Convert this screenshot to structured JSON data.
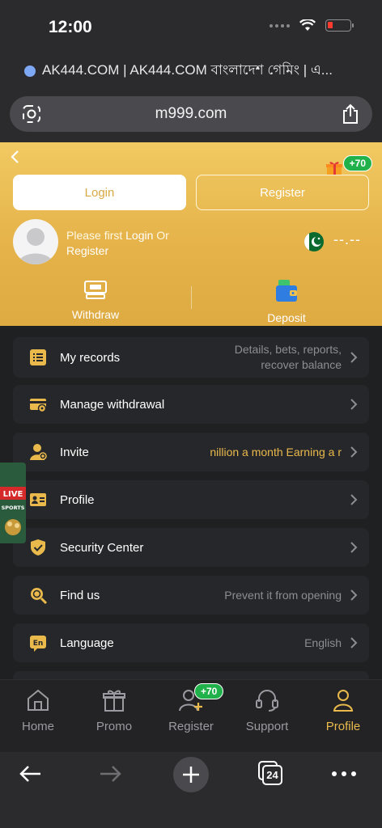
{
  "status": {
    "time": "12:00"
  },
  "browser": {
    "tab_title": "AK444.COM | AK444.COM বাংলাদেশ গেমিং | এ...",
    "url": "m999.com",
    "tab_count": "24"
  },
  "header": {
    "bonus_badge": "+70",
    "login_label": "Login",
    "register_label": "Register",
    "prompt_prefix": "Please first",
    "prompt_login": "Login",
    "prompt_or": "Or",
    "prompt_register": "Register",
    "balance": "--.--",
    "withdraw_label": "Withdraw",
    "deposit_label": "Deposit"
  },
  "menu": [
    {
      "label": "My records",
      "desc_line1": "Details, bets, reports,",
      "desc_line2": "recover balance",
      "icon": "records-icon"
    },
    {
      "label": "Manage withdrawal",
      "desc_line1": "",
      "desc_line2": "",
      "icon": "withdrawal-card-icon"
    },
    {
      "label": "Invite",
      "desc_line1": "nillion a month  Earning a r",
      "desc_line2": "",
      "icon": "invite-icon"
    },
    {
      "label": "Profile",
      "desc_line1": "",
      "desc_line2": "",
      "icon": "profile-card-icon"
    },
    {
      "label": "Security Center",
      "desc_line1": "",
      "desc_line2": "",
      "icon": "shield-icon"
    },
    {
      "label": "Find us",
      "desc_line1": "Prevent it from opening",
      "desc_line2": "",
      "icon": "find-us-icon"
    },
    {
      "label": "Language",
      "desc_line1": "English",
      "desc_line2": "",
      "icon": "language-icon"
    }
  ],
  "live_ad": {
    "line1": "LIVE",
    "line2": "SPORTS"
  },
  "bottom_nav": [
    {
      "label": "Home",
      "icon": "home-icon"
    },
    {
      "label": "Promo",
      "icon": "gift-icon"
    },
    {
      "label": "Register",
      "icon": "add-user-icon",
      "badge": "+70"
    },
    {
      "label": "Support",
      "icon": "headset-icon"
    },
    {
      "label": "Profile",
      "icon": "user-icon",
      "active": true
    }
  ],
  "colors": {
    "accent_gold": "#e9b94c",
    "header_gold": "#eec05b",
    "badge_green": "#21b14a"
  }
}
